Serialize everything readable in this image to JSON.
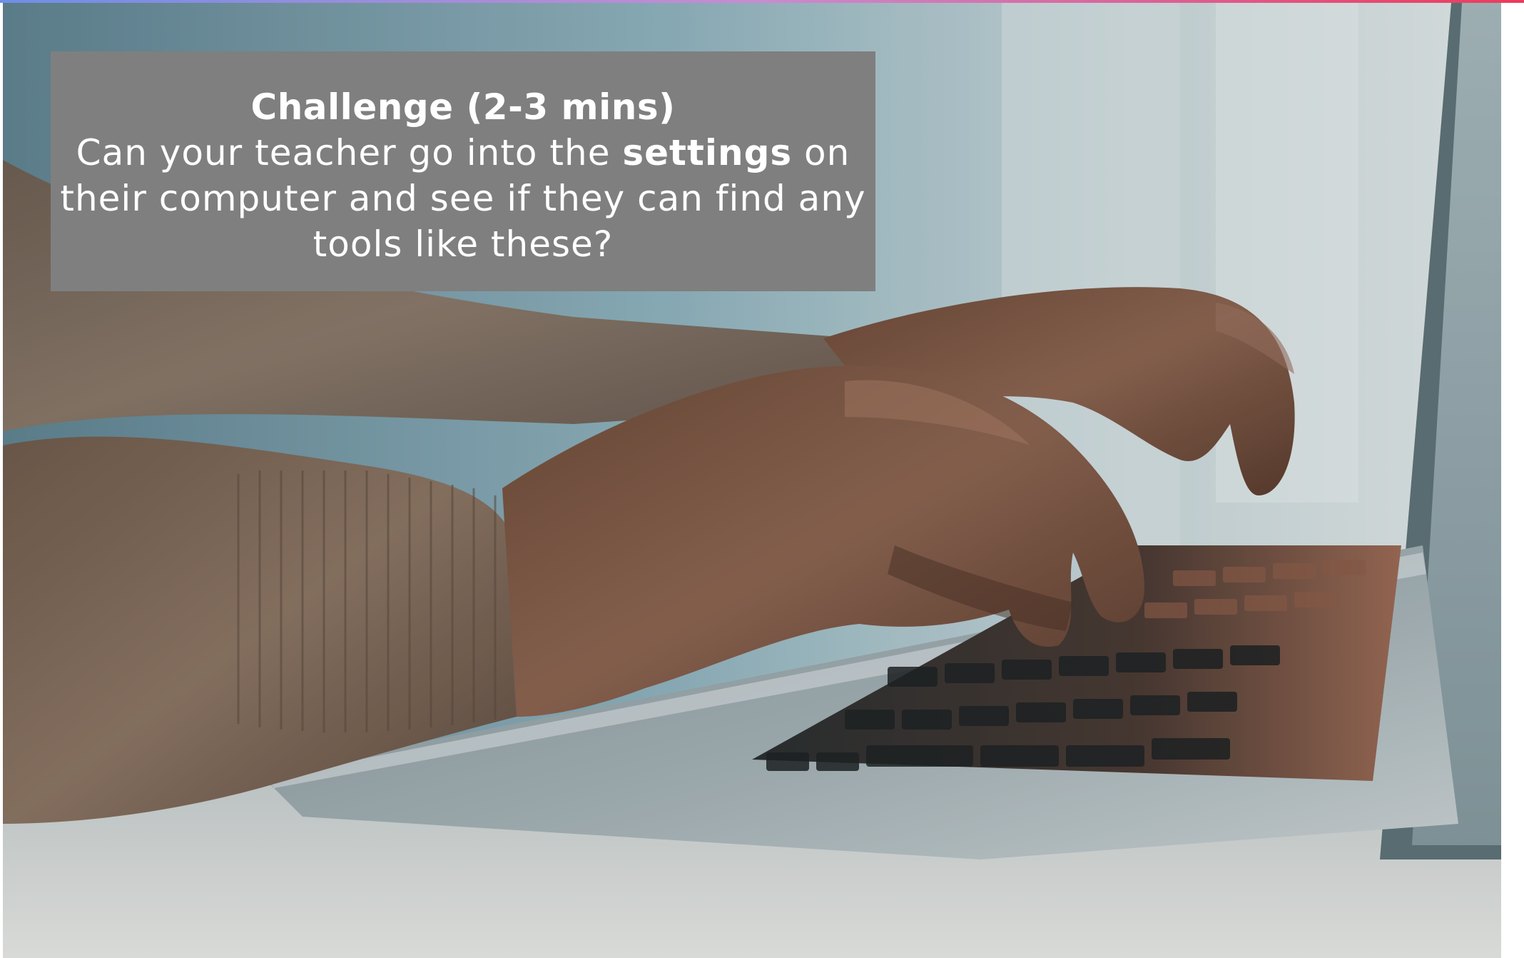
{
  "callout": {
    "title": "Challenge (2-3 mins)",
    "body_before": "Can your teacher go into the ",
    "body_emphasis": "settings",
    "body_after": " on their computer and see if they can find any tools like these?"
  },
  "image": {
    "icon": "photo-hands-typing-on-laptop"
  },
  "colors": {
    "callout_background": "#7f7f7f",
    "callout_text": "#ffffff",
    "accent_start": "#6f8fe6",
    "accent_end": "#ec3a5b"
  }
}
